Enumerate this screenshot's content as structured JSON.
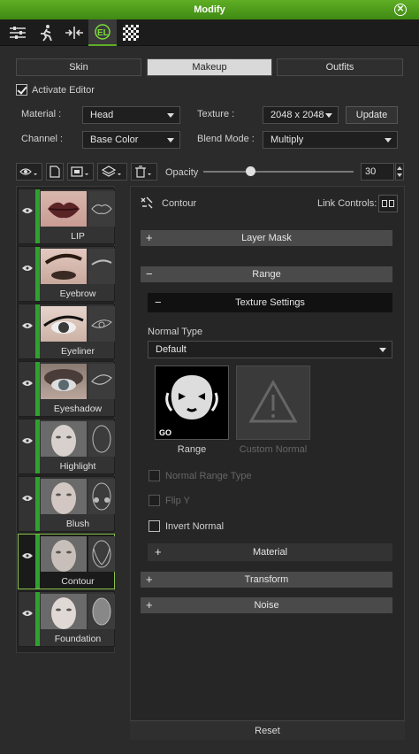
{
  "window": {
    "title": "Modify"
  },
  "toolbar": {
    "icons": [
      "sliders-icon",
      "pose-icon",
      "transform-icon",
      "appearance-icon",
      "checker-icon"
    ]
  },
  "tabs": [
    {
      "label": "Skin",
      "active": false
    },
    {
      "label": "Makeup",
      "active": true
    },
    {
      "label": "Outfits",
      "active": false
    }
  ],
  "activate_editor": {
    "label": "Activate Editor",
    "checked": true
  },
  "material": {
    "label": "Material :",
    "value": "Head"
  },
  "texture": {
    "label": "Texture :",
    "value": "2048 x 2048",
    "update_label": "Update"
  },
  "channel": {
    "label": "Channel :",
    "value": "Base Color"
  },
  "blend_mode": {
    "label": "Blend Mode :",
    "value": "Multiply"
  },
  "opacity": {
    "label": "Opacity",
    "value": "30",
    "fraction": 0.3
  },
  "layers": [
    {
      "name": "LIP",
      "selected": false
    },
    {
      "name": "Eyebrow",
      "selected": false
    },
    {
      "name": "Eyeliner",
      "selected": false
    },
    {
      "name": "Eyeshadow",
      "selected": false
    },
    {
      "name": "Highlight",
      "selected": false
    },
    {
      "name": "Blush",
      "selected": false
    },
    {
      "name": "Contour",
      "selected": true
    },
    {
      "name": "Foundation",
      "selected": false
    }
  ],
  "detail": {
    "title": "Contour",
    "link_controls": "Link Controls:",
    "layer_mask": "Layer Mask",
    "range": "Range",
    "texture_settings": "Texture Settings",
    "normal_type_label": "Normal Type",
    "normal_type_value": "Default",
    "thumb_range_label": "Range",
    "thumb_custom_label": "Custom Normal",
    "normal_range_type": "Normal Range Type",
    "flip_y": "Flip Y",
    "invert_normal": "Invert Normal",
    "material": "Material",
    "transform": "Transform",
    "noise": "Noise",
    "reset": "Reset"
  },
  "colors": {
    "accent": "#5fae24",
    "layer_green": "#2ea12e"
  }
}
